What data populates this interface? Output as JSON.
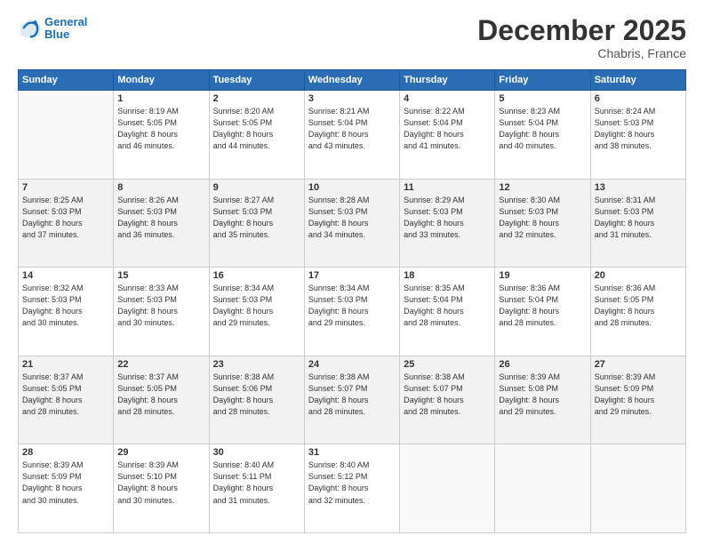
{
  "header": {
    "logo_line1": "General",
    "logo_line2": "Blue",
    "month": "December 2025",
    "location": "Chabris, France"
  },
  "columns": [
    "Sunday",
    "Monday",
    "Tuesday",
    "Wednesday",
    "Thursday",
    "Friday",
    "Saturday"
  ],
  "weeks": [
    {
      "shade": "white",
      "days": [
        {
          "num": "",
          "info": ""
        },
        {
          "num": "1",
          "info": "Sunrise: 8:19 AM\nSunset: 5:05 PM\nDaylight: 8 hours\nand 46 minutes."
        },
        {
          "num": "2",
          "info": "Sunrise: 8:20 AM\nSunset: 5:05 PM\nDaylight: 8 hours\nand 44 minutes."
        },
        {
          "num": "3",
          "info": "Sunrise: 8:21 AM\nSunset: 5:04 PM\nDaylight: 8 hours\nand 43 minutes."
        },
        {
          "num": "4",
          "info": "Sunrise: 8:22 AM\nSunset: 5:04 PM\nDaylight: 8 hours\nand 41 minutes."
        },
        {
          "num": "5",
          "info": "Sunrise: 8:23 AM\nSunset: 5:04 PM\nDaylight: 8 hours\nand 40 minutes."
        },
        {
          "num": "6",
          "info": "Sunrise: 8:24 AM\nSunset: 5:03 PM\nDaylight: 8 hours\nand 38 minutes."
        }
      ]
    },
    {
      "shade": "gray",
      "days": [
        {
          "num": "7",
          "info": "Sunrise: 8:25 AM\nSunset: 5:03 PM\nDaylight: 8 hours\nand 37 minutes."
        },
        {
          "num": "8",
          "info": "Sunrise: 8:26 AM\nSunset: 5:03 PM\nDaylight: 8 hours\nand 36 minutes."
        },
        {
          "num": "9",
          "info": "Sunrise: 8:27 AM\nSunset: 5:03 PM\nDaylight: 8 hours\nand 35 minutes."
        },
        {
          "num": "10",
          "info": "Sunrise: 8:28 AM\nSunset: 5:03 PM\nDaylight: 8 hours\nand 34 minutes."
        },
        {
          "num": "11",
          "info": "Sunrise: 8:29 AM\nSunset: 5:03 PM\nDaylight: 8 hours\nand 33 minutes."
        },
        {
          "num": "12",
          "info": "Sunrise: 8:30 AM\nSunset: 5:03 PM\nDaylight: 8 hours\nand 32 minutes."
        },
        {
          "num": "13",
          "info": "Sunrise: 8:31 AM\nSunset: 5:03 PM\nDaylight: 8 hours\nand 31 minutes."
        }
      ]
    },
    {
      "shade": "white",
      "days": [
        {
          "num": "14",
          "info": "Sunrise: 8:32 AM\nSunset: 5:03 PM\nDaylight: 8 hours\nand 30 minutes."
        },
        {
          "num": "15",
          "info": "Sunrise: 8:33 AM\nSunset: 5:03 PM\nDaylight: 8 hours\nand 30 minutes."
        },
        {
          "num": "16",
          "info": "Sunrise: 8:34 AM\nSunset: 5:03 PM\nDaylight: 8 hours\nand 29 minutes."
        },
        {
          "num": "17",
          "info": "Sunrise: 8:34 AM\nSunset: 5:03 PM\nDaylight: 8 hours\nand 29 minutes."
        },
        {
          "num": "18",
          "info": "Sunrise: 8:35 AM\nSunset: 5:04 PM\nDaylight: 8 hours\nand 28 minutes."
        },
        {
          "num": "19",
          "info": "Sunrise: 8:36 AM\nSunset: 5:04 PM\nDaylight: 8 hours\nand 28 minutes."
        },
        {
          "num": "20",
          "info": "Sunrise: 8:36 AM\nSunset: 5:05 PM\nDaylight: 8 hours\nand 28 minutes."
        }
      ]
    },
    {
      "shade": "gray",
      "days": [
        {
          "num": "21",
          "info": "Sunrise: 8:37 AM\nSunset: 5:05 PM\nDaylight: 8 hours\nand 28 minutes."
        },
        {
          "num": "22",
          "info": "Sunrise: 8:37 AM\nSunset: 5:05 PM\nDaylight: 8 hours\nand 28 minutes."
        },
        {
          "num": "23",
          "info": "Sunrise: 8:38 AM\nSunset: 5:06 PM\nDaylight: 8 hours\nand 28 minutes."
        },
        {
          "num": "24",
          "info": "Sunrise: 8:38 AM\nSunset: 5:07 PM\nDaylight: 8 hours\nand 28 minutes."
        },
        {
          "num": "25",
          "info": "Sunrise: 8:38 AM\nSunset: 5:07 PM\nDaylight: 8 hours\nand 28 minutes."
        },
        {
          "num": "26",
          "info": "Sunrise: 8:39 AM\nSunset: 5:08 PM\nDaylight: 8 hours\nand 29 minutes."
        },
        {
          "num": "27",
          "info": "Sunrise: 8:39 AM\nSunset: 5:09 PM\nDaylight: 8 hours\nand 29 minutes."
        }
      ]
    },
    {
      "shade": "white",
      "days": [
        {
          "num": "28",
          "info": "Sunrise: 8:39 AM\nSunset: 5:09 PM\nDaylight: 8 hours\nand 30 minutes."
        },
        {
          "num": "29",
          "info": "Sunrise: 8:39 AM\nSunset: 5:10 PM\nDaylight: 8 hours\nand 30 minutes."
        },
        {
          "num": "30",
          "info": "Sunrise: 8:40 AM\nSunset: 5:11 PM\nDaylight: 8 hours\nand 31 minutes."
        },
        {
          "num": "31",
          "info": "Sunrise: 8:40 AM\nSunset: 5:12 PM\nDaylight: 8 hours\nand 32 minutes."
        },
        {
          "num": "",
          "info": ""
        },
        {
          "num": "",
          "info": ""
        },
        {
          "num": "",
          "info": ""
        }
      ]
    }
  ]
}
